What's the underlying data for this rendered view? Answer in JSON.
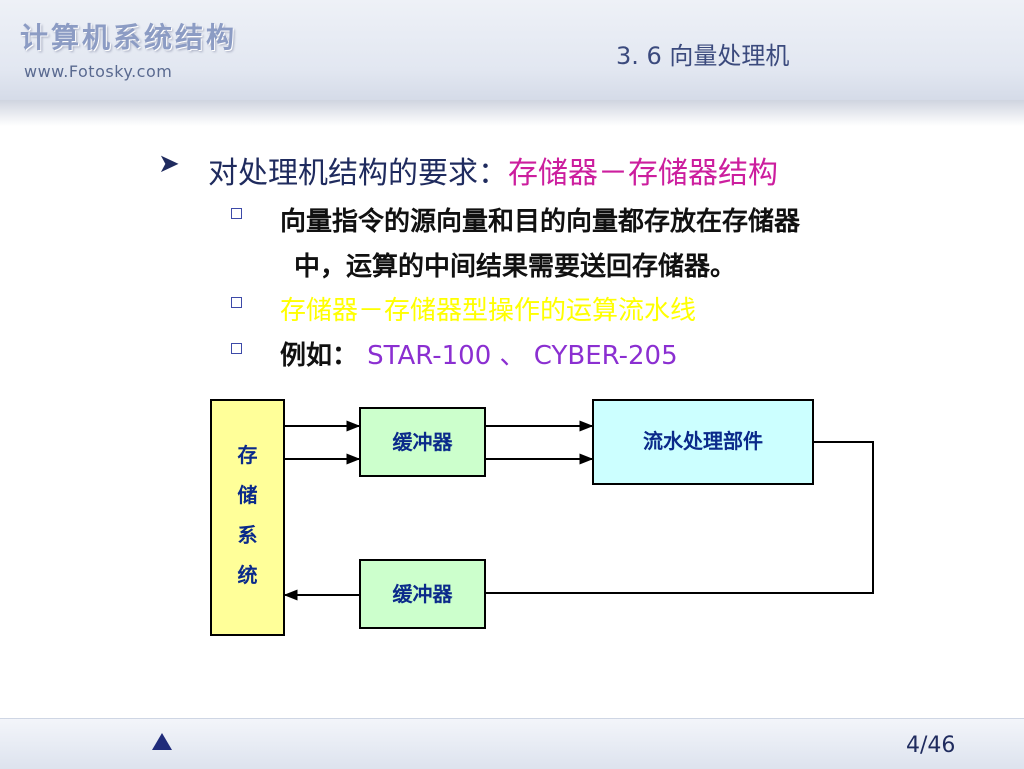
{
  "header": {
    "logo_title": "计算机系统结构",
    "logo_url": "www.Fotosky.com",
    "section": "3. 6  向量处理机"
  },
  "main": {
    "heading_prefix": "对处理机结构的要求：",
    "heading_accent": "存储器－存储器结构",
    "bullets": [
      {
        "line1": "向量指令的源向量和目的向量都存放在存储器",
        "line2": "中，运算的中间结果需要送回存储器。"
      },
      {
        "text": "存储器－存储器型操作的运算流水线"
      },
      {
        "label": "例如：",
        "examples": "STAR-100 、 CYBER-205"
      }
    ]
  },
  "diagram": {
    "memory_label": "存储系统",
    "memory_chars": [
      "存",
      "储",
      "系",
      "统"
    ],
    "buffer_top": "缓冲器",
    "buffer_bottom": "缓冲器",
    "pipeline_unit": "流水处理部件",
    "colors": {
      "memory": "#ffff99",
      "buffer": "#ccffcc",
      "pipeline": "#ccffff",
      "label": "#0a2a8a"
    }
  },
  "footer": {
    "nav_icon": "triangle-up-icon",
    "page": "4/46"
  }
}
